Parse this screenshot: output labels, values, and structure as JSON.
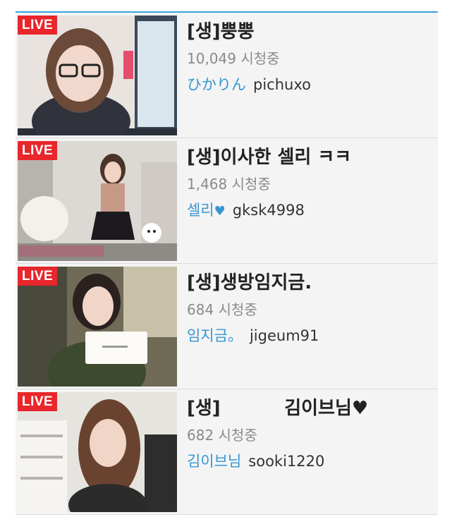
{
  "streams": [
    {
      "live_label": "LIVE",
      "title": "[생]뿡뿡",
      "viewers": "10,049 시청중",
      "nickname": "ひかりん",
      "user_id": "pichuxo"
    },
    {
      "live_label": "LIVE",
      "title": "[생]이사한 셀리 ㅋㅋ",
      "viewers": "1,468 시청중",
      "nickname": "셀리",
      "nickname_suffix": "♥",
      "user_id": "gksk4998"
    },
    {
      "live_label": "LIVE",
      "title": "[생]생방임지금.",
      "viewers": "684 시청중",
      "nickname": "임지금。",
      "user_id": "jigeum91"
    },
    {
      "live_label": "LIVE",
      "title": "[생]          김이브님♥",
      "viewers": "682 시청중",
      "nickname": "김이브님",
      "user_id": "sooki1220"
    }
  ]
}
